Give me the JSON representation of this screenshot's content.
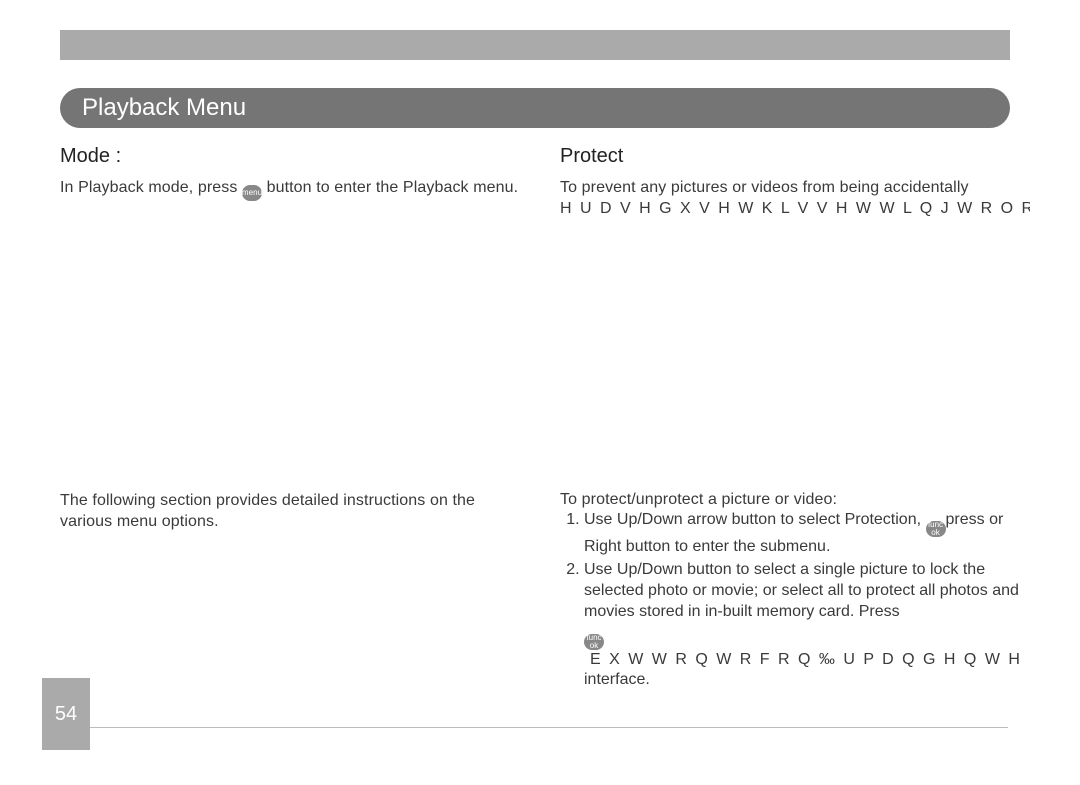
{
  "page_number": "54",
  "section_title": "Playback Menu",
  "left": {
    "heading": "Mode :",
    "intro_prefix": "In Playback mode, press ",
    "menu_icon_label": "menu",
    "intro_mid": " button to enter the ",
    "intro_suffix": "Playback menu.",
    "body": "The following section provides detailed instructions on the various menu options."
  },
  "right": {
    "heading": "Protect",
    "intro": "To prevent any pictures or videos from being accidentally",
    "glyph_line": "H U D V H G   X V H  W K L V  V H W W L Q J  W R  O R",
    "instructions_lead": "To protect/unprotect a picture or video:",
    "step1_prefix": "Use Up/Down arrow button to select Protection, ",
    "func_icon_label": "func ok",
    "step1_suffix": "press or Right button to enter the submenu.",
    "step2_prefix": "Use Up/Down button to select a single picture to lock the selected photo or movie; or select all to protect all photos and movies stored in in-built memory card. Press ",
    "step2_glyph": "E X W W R Q  W R  F R Q ‰ U P  D Q G  H Q W H",
    "step2_suffix": "interface."
  }
}
